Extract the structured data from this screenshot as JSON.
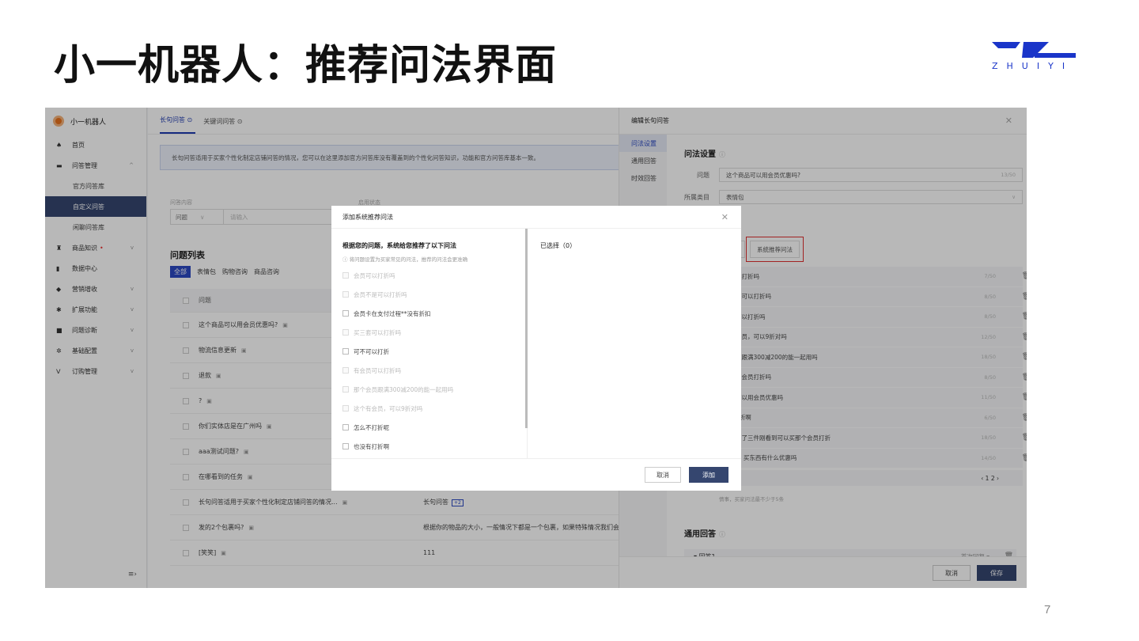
{
  "slide": {
    "title": "小一机器人：推荐问法界面",
    "page_number": "7",
    "logo_text": "ZHUIYI",
    "brand_color": "#1a35c9"
  },
  "sidebar": {
    "brand": "小一机器人",
    "items": [
      {
        "icon": "home-icon",
        "glyph": "♠",
        "label": "首页"
      },
      {
        "icon": "qa-icon",
        "glyph": "▬",
        "label": "问答管理",
        "chev": "^"
      },
      {
        "icon": "product-icon",
        "glyph": "♜",
        "label": "商品知识",
        "chev": "v",
        "dot": "•"
      },
      {
        "icon": "chart-icon",
        "glyph": "▮",
        "label": "数据中心"
      },
      {
        "icon": "tag-icon",
        "glyph": "◆",
        "label": "营销增收",
        "chev": "v"
      },
      {
        "icon": "puzzle-icon",
        "glyph": "✱",
        "label": "扩展功能",
        "chev": "v"
      },
      {
        "icon": "diagnose-icon",
        "glyph": "■",
        "label": "问题诊断",
        "chev": "v"
      },
      {
        "icon": "gear-icon",
        "glyph": "✲",
        "label": "基础配置",
        "chev": "v"
      },
      {
        "icon": "cart-icon",
        "glyph": "ᐯ",
        "label": "订购管理",
        "chev": "v"
      }
    ],
    "sub_items": [
      "官方问答库",
      "自定义问答",
      "闲聊问答库"
    ],
    "fold_glyph": "≡›"
  },
  "main": {
    "tabs": [
      "长句问答 ⊙",
      "关键词问答 ⊙"
    ],
    "notice": "长句问答适用于买家个性化制定店铺问答的情况，您可以在这里添加官方问答库没有覆盖到的个性化问答知识，功能和官方问答库基本一致。",
    "filter_label_1": "问答内容",
    "filter_label_2": "启用状态",
    "select_value": "问题",
    "input_placeholder": "请输入",
    "list_title": "问题列表",
    "chips": [
      "全部",
      "表情包",
      "购物咨询",
      "商品咨询"
    ],
    "header": "问题",
    "rows": [
      {
        "q": "这个商品可以用会员优惠吗?",
        "a": ""
      },
      {
        "q": "物流信息更新",
        "a": ""
      },
      {
        "q": "退款",
        "a": ""
      },
      {
        "q": "?",
        "a": ""
      },
      {
        "q": "你们实体店是在广州吗",
        "a": ""
      },
      {
        "q": "aaa测试问题?",
        "a": ""
      },
      {
        "q": "在哪看到的任务",
        "a": ""
      },
      {
        "q": "长句问答适用于买家个性化制定店铺问答的情况...",
        "a": "长句问答",
        "tag": "+2"
      },
      {
        "q": "发的2个包裹吗?",
        "a": "根据你的物品的大小，一般情况下都是一个包裹，如果特殊情况我们会"
      },
      {
        "q": "[笑笑]",
        "a": "111"
      }
    ]
  },
  "panel": {
    "title": "编辑长句问答",
    "nav": [
      "问法设置",
      "通用回答",
      "时效回答"
    ],
    "section_title": "问法设置",
    "question_label": "问题",
    "question_value": "这个商品可以用会员优惠吗?",
    "question_count": "13/50",
    "category_label": "所属类目",
    "category_value": "表情包",
    "tab_a": "问法",
    "tab_b": "系统推荐问法",
    "suggestions": [
      {
        "text": "品可以打折吗",
        "cnt": "7/50"
      },
      {
        "text": "品不是可以打折吗",
        "cnt": "8/50"
      },
      {
        "text": "会员可以打折吗",
        "cnt": "8/50"
      },
      {
        "text": "个有会员，可以9折对吗",
        "cnt": "12/50"
      },
      {
        "text": "个会员跟满300减200的能一起用吗",
        "cnt": "18/50"
      },
      {
        "text": "买，有会员打折吗",
        "cnt": "8/50"
      },
      {
        "text": "礼包可以用会员优惠吗",
        "cnt": "11/50"
      },
      {
        "text": "品打9折啊",
        "cnt": "6/50"
      },
      {
        "text": "这边买了三件刚看到可以买那个会员打折",
        "cnt": "18/50"
      },
      {
        "text": "的会员 买东西有什么优惠吗",
        "cnt": "14/50"
      }
    ],
    "pager_left": "条",
    "pager": "‹ 1 2 ›",
    "note": "情事，买家问法最不少于5条",
    "general_title": "通用回答",
    "answer_label": "▾ 回答1",
    "answer_right": "首次回复 ▾",
    "cancel": "取消",
    "save": "保存"
  },
  "modal": {
    "title": "添加系统推荐问法",
    "left_title": "根据您的问题，系统给您推荐了以下问法",
    "tip": "ⓘ 将问题设置为买家常见的问法，推荐的问法会更准确",
    "options": [
      {
        "text": "会员可以打折吗",
        "on": false
      },
      {
        "text": "会员不是可以打折吗",
        "on": false
      },
      {
        "text": "会员卡在支付过程**没有折扣",
        "on": true
      },
      {
        "text": "买三套可以打折吗",
        "on": false
      },
      {
        "text": "可不可以打折",
        "on": true
      },
      {
        "text": "有会员可以打折吗",
        "on": false
      },
      {
        "text": "那个会员跟满300减200的能一起用吗",
        "on": false
      },
      {
        "text": "这个有会员，可以9折对吗",
        "on": false
      },
      {
        "text": "怎么不打折呢",
        "on": true
      },
      {
        "text": "也没有打折啊",
        "on": true
      }
    ],
    "selected": "已选择（0）",
    "cancel": "取消",
    "add": "添加"
  }
}
